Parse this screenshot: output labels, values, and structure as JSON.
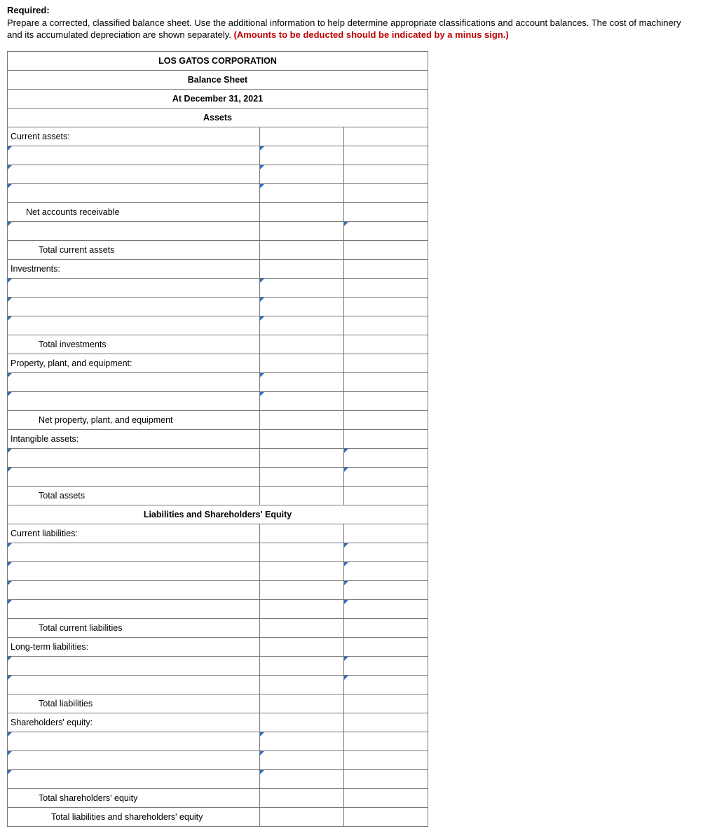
{
  "instructions": {
    "required_label": "Required:",
    "body1": "Prepare a corrected, classified balance sheet. Use the additional information to help determine appropriate classifications and account balances. The cost of machinery and its accumulated depreciation are shown separately. ",
    "red": "(Amounts to be deducted should be indicated by a minus sign.)"
  },
  "sheet": {
    "company": "LOS GATOS CORPORATION",
    "title": "Balance Sheet",
    "date": "At December 31, 2021",
    "section_assets": "Assets",
    "current_assets": "Current assets:",
    "net_ar": "Net accounts receivable",
    "total_current_assets": "Total current assets",
    "investments": "Investments:",
    "total_investments": "Total investments",
    "ppe": "Property, plant, and equipment:",
    "net_ppe": "Net property, plant, and equipment",
    "intangibles": "Intangible assets:",
    "total_assets": "Total assets",
    "section_liab": "Liabilities and Shareholders' Equity",
    "current_liab": "Current liabilities:",
    "total_current_liab": "Total current liabilities",
    "lt_liab": "Long-term liabilities:",
    "total_liab": "Total liabilities",
    "se": "Shareholders' equity:",
    "total_se": "Total shareholders' equity",
    "total_liab_se": "Total liabilities and shareholders' equity"
  }
}
